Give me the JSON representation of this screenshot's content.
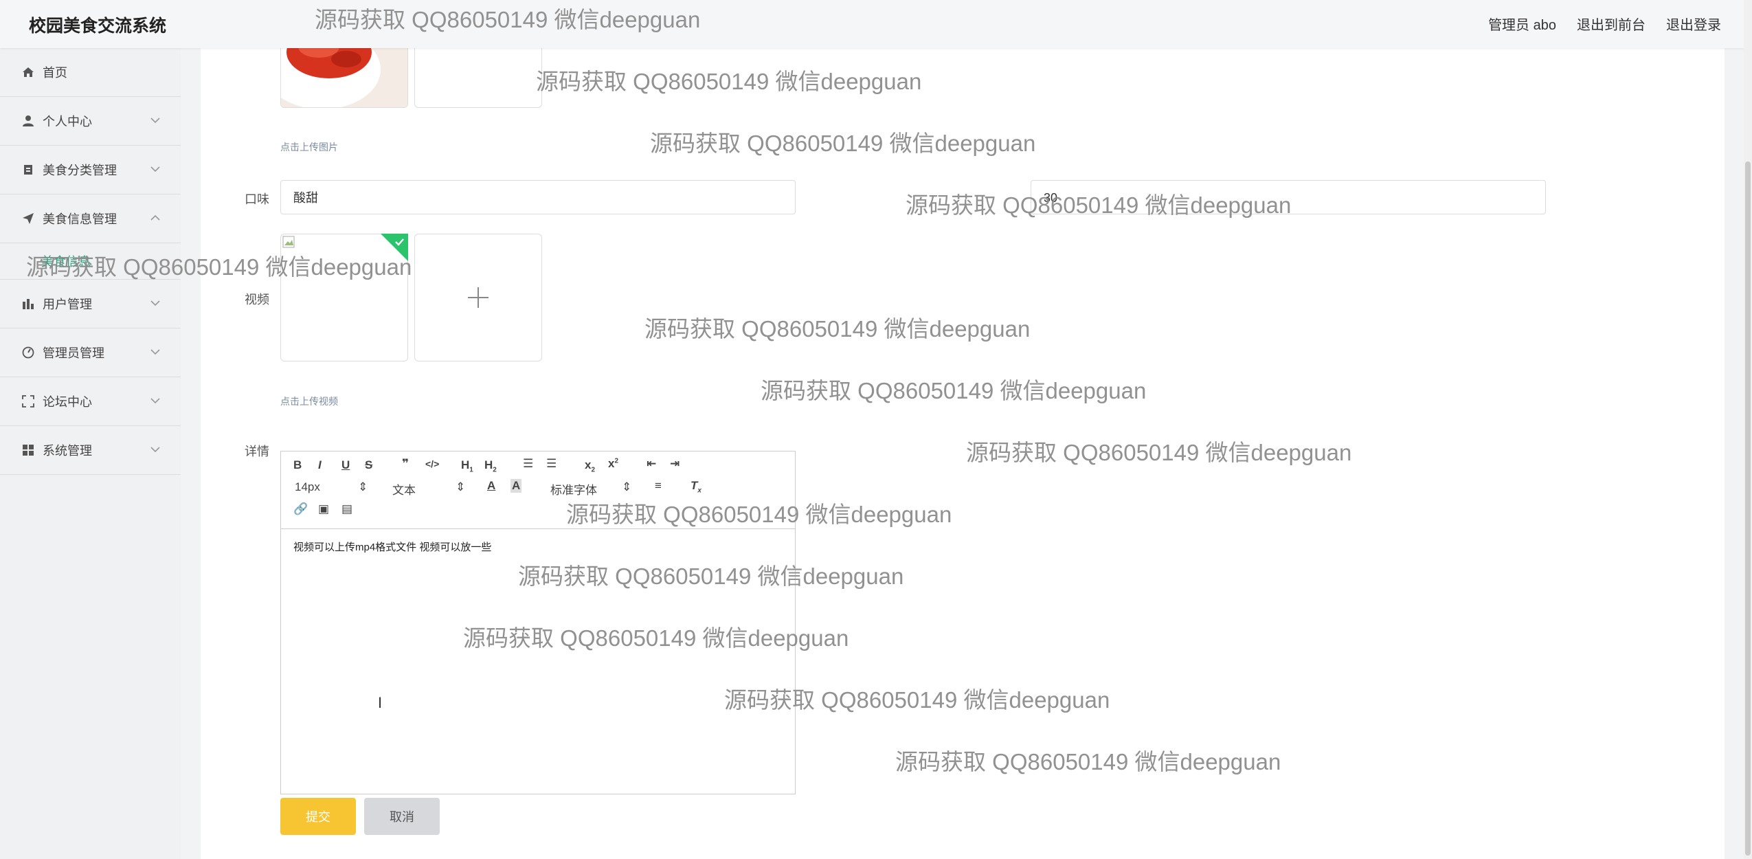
{
  "header": {
    "title": "校园美食交流系统",
    "user_label": "管理员 abo",
    "front_label": "退出到前台",
    "logout_label": "退出登录"
  },
  "sidebar": {
    "items": [
      {
        "label": "首页",
        "icon": "home-icon"
      },
      {
        "label": "个人中心",
        "icon": "user-icon"
      },
      {
        "label": "美食分类管理",
        "icon": "category-icon"
      },
      {
        "label": "美食信息管理",
        "icon": "send-icon"
      },
      {
        "label": "用户管理",
        "icon": "bar-chart-icon"
      },
      {
        "label": "管理员管理",
        "icon": "dashboard-icon"
      },
      {
        "label": "论坛中心",
        "icon": "expand-icon"
      },
      {
        "label": "系统管理",
        "icon": "grid-icon"
      }
    ],
    "submenu_label": "美食信息"
  },
  "form": {
    "image_hint": "点击上传图片",
    "taste_label": "口味",
    "taste_value": "酸甜",
    "field2_value": "30",
    "video_label": "视频",
    "video_hint": "点击上传视频",
    "detail_label": "详情",
    "submit_label": "提交",
    "cancel_label": "取消"
  },
  "editor": {
    "font_size": "14px",
    "paragraph": "文本",
    "font_family": "标准字体",
    "content": "视频可以上传mp4格式文件   视频可以放一些"
  },
  "watermark": "源码获取 QQ86050149 微信deepguan",
  "colors": {
    "accent": "#2e9b79",
    "submit": "#f7c531",
    "cancel": "#d6d8dc"
  }
}
